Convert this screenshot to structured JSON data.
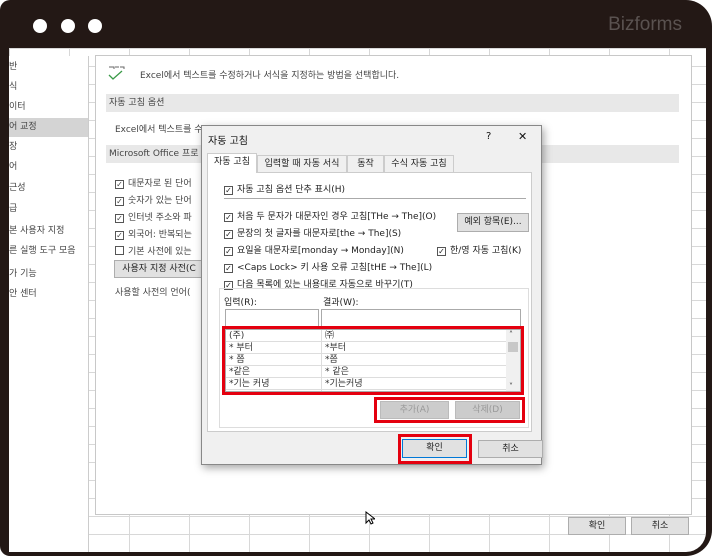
{
  "brand": "Bizforms",
  "nav": [
    "반",
    "식",
    "이터",
    "어 교정",
    "장",
    "어",
    "근성",
    "급",
    "본 사용자 지정",
    "른 실행 도구 모음",
    "가 기능",
    "안 센터"
  ],
  "nav_selected": 3,
  "main": {
    "intro": "Excel에서 텍스트를 수정하거나 서식을 지정하는 방법을 선택합니다.",
    "section1": "자동 고침 옵션",
    "section1_text": "Excel에서 텍스트를 수",
    "section2": "Microsoft Office 프로",
    "checks": [
      {
        "label": "대문자로 된 단어",
        "checked": true
      },
      {
        "label": "숫자가 있는 단어",
        "checked": true
      },
      {
        "label": "인터넷 주소와 파",
        "checked": true
      },
      {
        "label": "외국어: 반복되는",
        "checked": true
      },
      {
        "label": "기본 사전에 있는",
        "checked": false
      }
    ],
    "custom_dict_button": "사용자 지정 사전(C",
    "dict_lang": "사용할 사전의 언어(",
    "ok": "확인",
    "cancel": "취소"
  },
  "dialog": {
    "title": "자동 고침",
    "help": "?",
    "close": "✕",
    "tabs": [
      "자동 고침",
      "입력할 때 자동 서식",
      "동작",
      "수식 자동 고침"
    ],
    "show_buttons": "자동 고침 옵션 단추 표시(H)",
    "options": [
      "처음 두 문자가 대문자인 경우 고침[THe → The](O)",
      "문장의 첫 글자를 대문자로[the → The](S)",
      "요일을 대문자로[monday → Monday](N)",
      "<Caps Lock> 키 사용 오류 고침[tHE → The](L)",
      "다음 목록에 있는 내용대로 자동으로 바꾸기(T)"
    ],
    "exceptions_button": "예외 항목(E)...",
    "hanyoung": "한/영 자동 고침(K)",
    "input_label": "입력(R):",
    "result_label": "결과(W):",
    "input_value": "",
    "result_value": "",
    "list": [
      [
        "(주)",
        "㈜"
      ],
      [
        "* 부터",
        "*부터"
      ],
      [
        "* 쯤",
        "*쯤"
      ],
      [
        "*같은",
        "* 같은"
      ],
      [
        "*기는 커녕",
        "*기는커녕"
      ]
    ],
    "add_button": "추가(A)",
    "delete_button": "삭제(D)",
    "ok": "확인",
    "cancel": "취소"
  }
}
